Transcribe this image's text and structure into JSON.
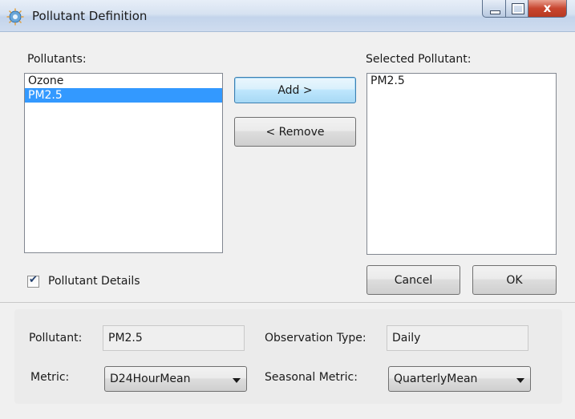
{
  "window": {
    "title": "Pollutant Definition",
    "icon": "globe-app-icon"
  },
  "pollutants": {
    "label": "Pollutants:",
    "items": [
      "Ozone",
      "PM2.5"
    ],
    "selected": "PM2.5"
  },
  "selected_pollutant": {
    "label": "Selected Pollutant:",
    "items": [
      "PM2.5"
    ]
  },
  "buttons": {
    "add": "Add >",
    "remove": "< Remove",
    "cancel": "Cancel",
    "ok": "OK"
  },
  "details_checkbox": {
    "label": "Pollutant Details",
    "checked": true
  },
  "details": {
    "pollutant_label": "Pollutant:",
    "pollutant_value": "PM2.5",
    "observation_type_label": "Observation Type:",
    "observation_type_value": "Daily",
    "metric_label": "Metric:",
    "metric_value": "D24HourMean",
    "seasonal_metric_label": "Seasonal Metric:",
    "seasonal_metric_value": "QuarterlyMean"
  },
  "colors": {
    "selection": "#3399ff",
    "close_button": "#c8452f"
  }
}
